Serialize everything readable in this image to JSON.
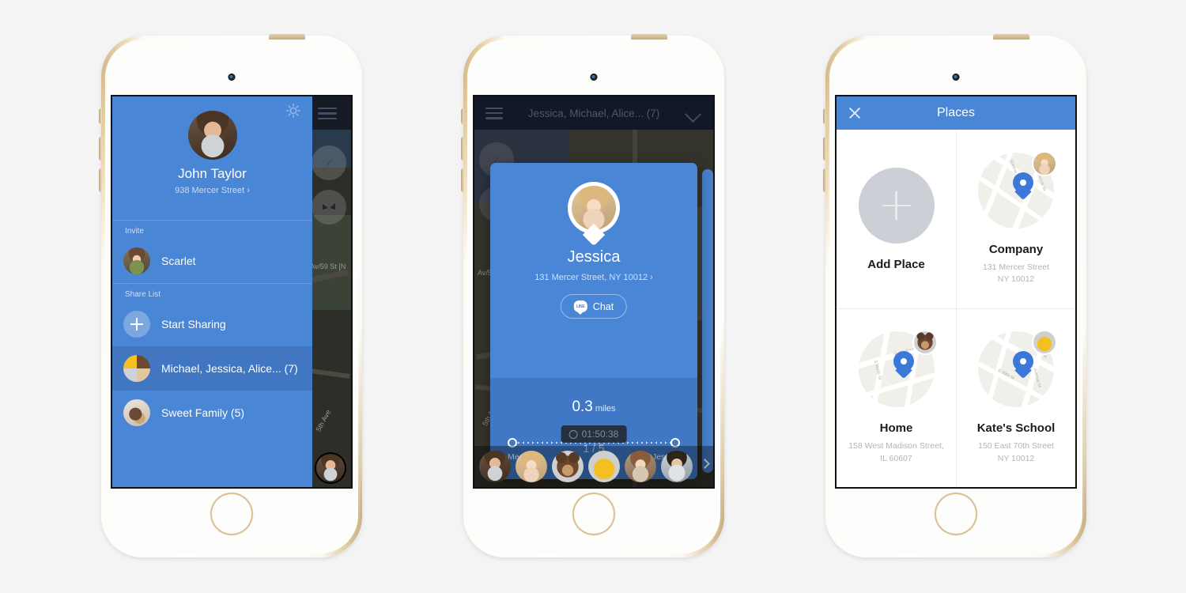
{
  "phone1": {
    "name": "sidebar-drawer-screen",
    "map": {
      "street_label_1": "Av/59 St [N",
      "street_label_2": "5th Ave"
    },
    "gear_icon": "gear-icon",
    "profile": {
      "name": "John Taylor",
      "address": "938 Mercer Street ›"
    },
    "sections": [
      {
        "label": "Invite"
      },
      {
        "label": "Share List"
      }
    ],
    "invite_rows": [
      {
        "label": "Scarlet",
        "avatar": "ph-scarlet"
      }
    ],
    "share_rows": [
      {
        "label": "Start Sharing",
        "avatar": "plus"
      },
      {
        "label": "Michael, Jessica, Alice... (7)",
        "avatar": "ph-grp",
        "highlighted": true
      },
      {
        "label": "Sweet Family (5)",
        "avatar": "ph-dog",
        "highlighted": false
      }
    ]
  },
  "phone2": {
    "name": "person-card-screen",
    "header": {
      "title": "Jessica, Michael, Alice... (7)",
      "menu_icon": "hamburger-icon",
      "chevron_icon": "chevron-down-icon"
    },
    "card": {
      "name": "Jessica",
      "address": "131 Mercer Street, NY 10012 ›",
      "chat_label": "Chat",
      "chat_icon": "line-chat-icon",
      "distance_value": "0.3",
      "distance_unit": "miles",
      "origin_label": "Me",
      "destination_label": "Jessica"
    },
    "timer": "01:50:38",
    "timer_icon": "clock-icon",
    "page_indicator": "1 / 5",
    "avatar_strip": [
      {
        "avatar": "ph-john"
      },
      {
        "avatar": "ph-jess"
      },
      {
        "avatar": "ph-bear"
      },
      {
        "avatar": "ph-duck"
      },
      {
        "avatar": "ph-alice"
      },
      {
        "avatar": "ph-kid"
      }
    ],
    "next_icon": "chevron-right-icon"
  },
  "phone3": {
    "name": "places-screen",
    "header": {
      "title": "Places",
      "close_icon": "close-icon"
    },
    "places": [
      {
        "title": "Add Place",
        "address_line1": "",
        "address_line2": "",
        "kind": "add",
        "icon": "plus-icon"
      },
      {
        "title": "Company",
        "address_line1": "131 Mercer Street",
        "address_line2": "NY 10012",
        "kind": "map",
        "badge": "ph-jess",
        "streets": [
          "Greene St",
          "Mercer St"
        ]
      },
      {
        "title": "Home",
        "address_line1": "158 West Madison Street,",
        "address_line2": "IL 60607",
        "kind": "map",
        "badge": "ph-bear",
        "streets": [
          "W Madison St",
          "S Wells St"
        ]
      },
      {
        "title": "Kate's School",
        "address_line1": "150 East 70th Street",
        "address_line2": "NY 10012",
        "kind": "map",
        "badge": "ph-duck",
        "streets": [
          "E 70th St",
          "E 69th St",
          "Avenue M"
        ]
      }
    ]
  },
  "theme": {
    "brand_blue": "#4a86d6",
    "brand_blue_dark": "#4078c6",
    "header_navy": "#111827",
    "background": "#f4f4f4"
  }
}
